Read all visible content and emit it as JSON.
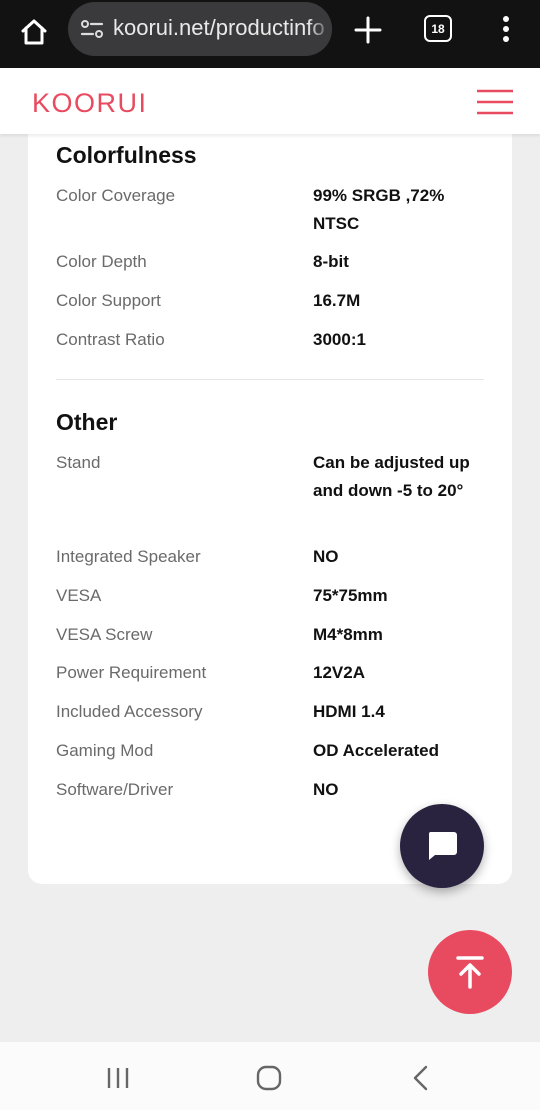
{
  "browser": {
    "url": "koorui.net/productinfo",
    "tab_count": "18"
  },
  "header": {
    "logo_text": "KOORUI",
    "brand_color": "#e84a5f"
  },
  "sections": [
    {
      "title": "Colorfulness",
      "rows": [
        {
          "label": "Color Coverage",
          "value": "99% SRGB ,72% NTSC"
        },
        {
          "label": "Color Depth",
          "value": "8-bit"
        },
        {
          "label": "Color Support",
          "value": "16.7M"
        },
        {
          "label": "Contrast Ratio",
          "value": "3000:1"
        }
      ]
    },
    {
      "title": "Other",
      "rows": [
        {
          "label": "Stand",
          "value": "Can be adjusted up and down -5 to 20°"
        },
        {
          "label": "Integrated Speaker",
          "value": "NO"
        },
        {
          "label": "VESA",
          "value": "75*75mm"
        },
        {
          "label": "VESA Screw",
          "value": "M4*8mm"
        },
        {
          "label": "Power Requirement",
          "value": "12V2A"
        },
        {
          "label": "Included Accessory",
          "value": "HDMI 1.4"
        },
        {
          "label": "Gaming Mod",
          "value": "OD Accelerated"
        },
        {
          "label": "Software/Driver",
          "value": "NO"
        }
      ]
    }
  ],
  "icons": {
    "home": "home-icon",
    "site_info": "site-settings-icon",
    "new_tab": "plus-icon",
    "menu": "more-vertical-icon",
    "hamburger": "hamburger-menu-icon",
    "chat": "chat-bubble-icon",
    "back_to_top": "arrow-up-to-top-icon",
    "recents": "recent-apps-icon",
    "nav_home": "nav-home-icon",
    "back": "back-chevron-icon"
  }
}
